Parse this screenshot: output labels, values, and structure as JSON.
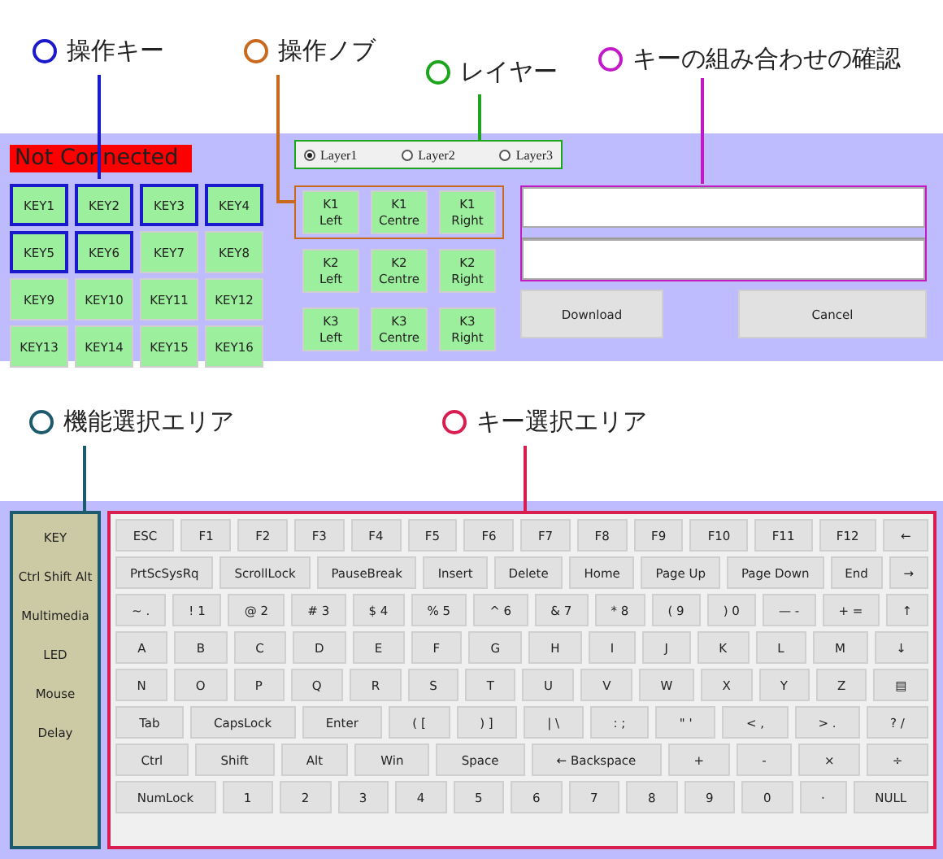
{
  "annotations": [
    {
      "label": "操作キー",
      "color": "#1a1acc"
    },
    {
      "label": "操作ノブ",
      "color": "#c8691e"
    },
    {
      "label": "レイヤー",
      "color": "#1ea51e"
    },
    {
      "label": "キーの組み合わせの確認",
      "color": "#c21ac8"
    },
    {
      "label": "機能選択エリア",
      "color": "#1e5a6e"
    },
    {
      "label": "キー選択エリア",
      "color": "#d81e50"
    }
  ],
  "status": "Not Connected",
  "keys": [
    {
      "label": "KEY1",
      "highlighted": true
    },
    {
      "label": "KEY2",
      "highlighted": true
    },
    {
      "label": "KEY3",
      "highlighted": true
    },
    {
      "label": "KEY4",
      "highlighted": true
    },
    {
      "label": "KEY5",
      "highlighted": true
    },
    {
      "label": "KEY6",
      "highlighted": true
    },
    {
      "label": "KEY7",
      "highlighted": false
    },
    {
      "label": "KEY8",
      "highlighted": false
    },
    {
      "label": "KEY9",
      "highlighted": false
    },
    {
      "label": "KEY10",
      "highlighted": false
    },
    {
      "label": "KEY11",
      "highlighted": false
    },
    {
      "label": "KEY12",
      "highlighted": false
    },
    {
      "label": "KEY13",
      "highlighted": false
    },
    {
      "label": "KEY14",
      "highlighted": false
    },
    {
      "label": "KEY15",
      "highlighted": false
    },
    {
      "label": "KEY16",
      "highlighted": false
    }
  ],
  "layers": [
    {
      "label": "Layer1",
      "selected": true
    },
    {
      "label": "Layer2",
      "selected": false
    },
    {
      "label": "Layer3",
      "selected": false
    }
  ],
  "knob_rows": [
    {
      "highlighted": true,
      "knobs": [
        "K1\nLeft",
        "K1\nCentre",
        "K1\nRight"
      ]
    },
    {
      "highlighted": false,
      "knobs": [
        "K2\nLeft",
        "K2\nCentre",
        "K2\nRight"
      ]
    },
    {
      "highlighted": false,
      "knobs": [
        "K3\nLeft",
        "K3\nCentre",
        "K3\nRight"
      ]
    }
  ],
  "buttons": [
    "Download",
    "Cancel"
  ],
  "functions": [
    "KEY",
    "Ctrl Shift Alt",
    "Multimedia",
    "LED",
    "Mouse",
    "Delay"
  ],
  "keyboard_rows": [
    [
      "ESC",
      "F1",
      "F2",
      "F3",
      "F4",
      "F5",
      "F6",
      "F7",
      "F8",
      "F9",
      "F10",
      "F11",
      "F12",
      "←"
    ],
    [
      "PrtScSysRq",
      "ScrollLock",
      "PauseBreak",
      "Insert",
      "Delete",
      "Home",
      "Page Up",
      "Page Down",
      "End",
      "→"
    ],
    [
      "~ .",
      "! 1",
      "@ 2",
      "# 3",
      "$ 4",
      "% 5",
      "^ 6",
      "& 7",
      "* 8",
      "( 9",
      ") 0",
      "— -",
      "+ =",
      "↑"
    ],
    [
      "A",
      "B",
      "C",
      "D",
      "E",
      "F",
      "G",
      "H",
      "I",
      "J",
      "K",
      "L",
      "M",
      "↓"
    ],
    [
      "N",
      "O",
      "P",
      "Q",
      "R",
      "S",
      "T",
      "U",
      "V",
      "W",
      "X",
      "Y",
      "Z",
      "▤"
    ],
    [
      "Tab",
      "CapsLock",
      "Enter",
      "( [",
      ") ]",
      "| \\",
      ": ;",
      "\" '",
      "< ,",
      "> .",
      "? /"
    ],
    [
      "Ctrl",
      "Shift",
      "Alt",
      "Win",
      "Space",
      "← Backspace",
      "+",
      "-",
      "×",
      "÷"
    ],
    [
      "NumLock",
      "1",
      "2",
      "3",
      "4",
      "5",
      "6",
      "7",
      "8",
      "9",
      "0",
      "·",
      "NULL"
    ]
  ]
}
